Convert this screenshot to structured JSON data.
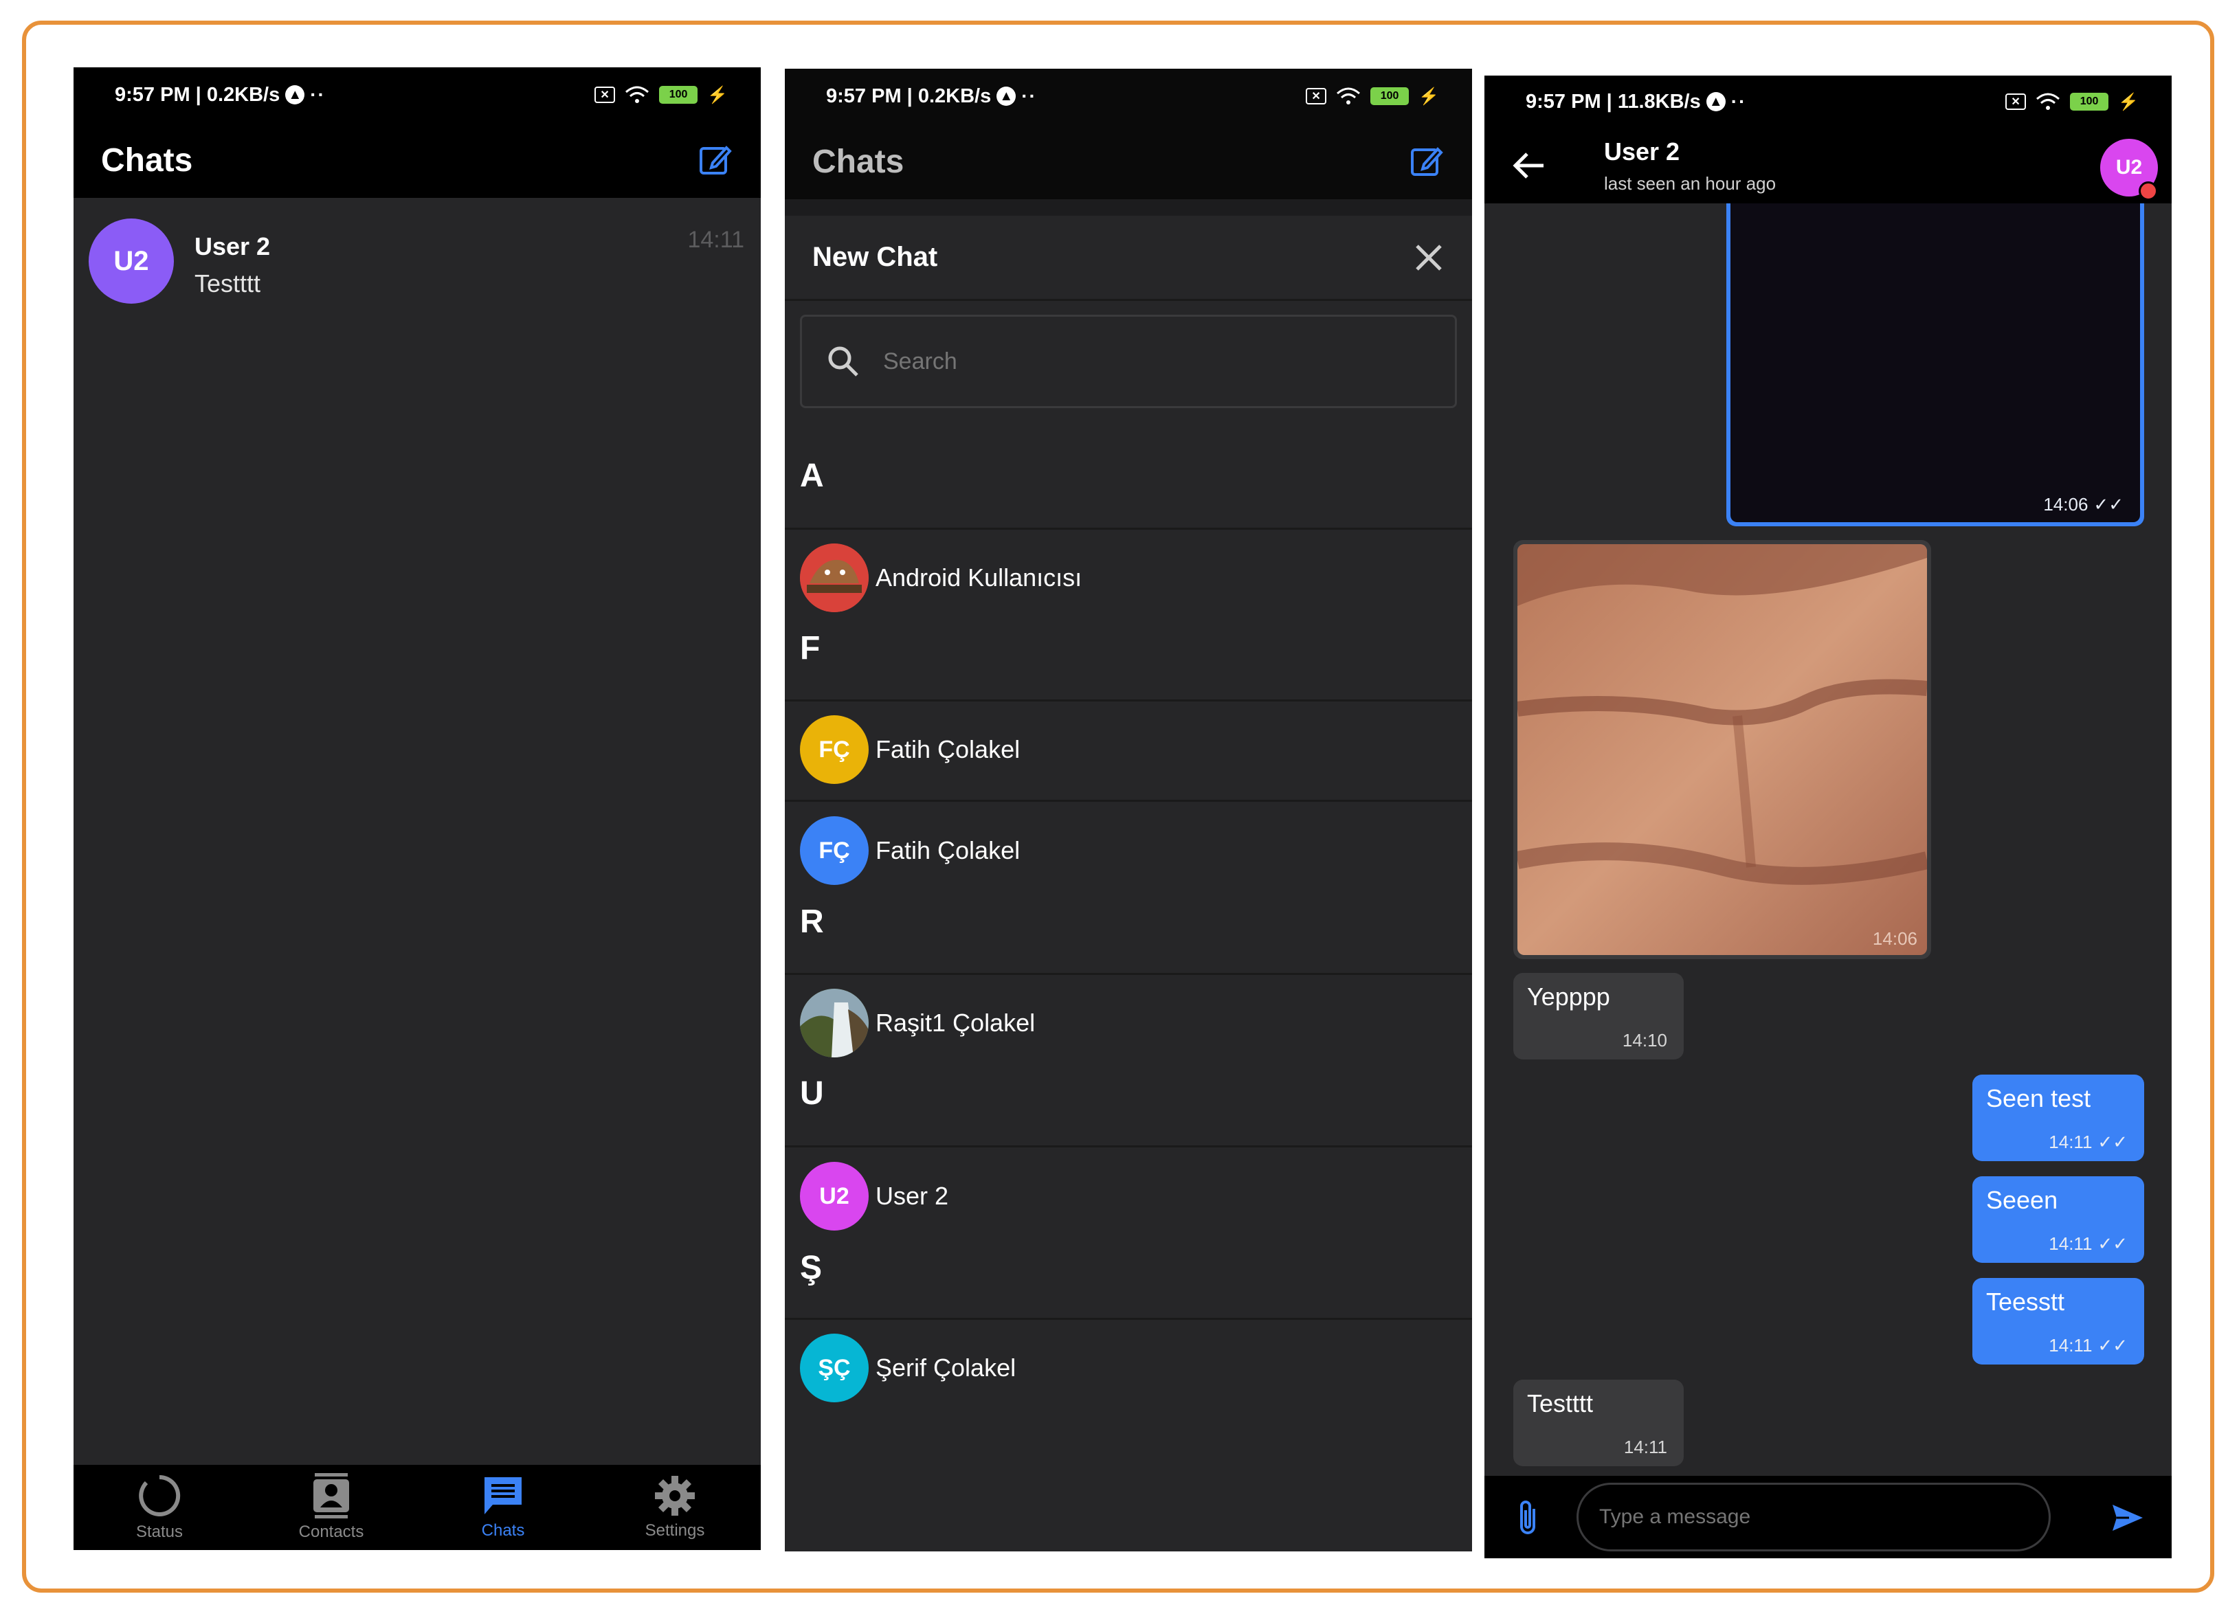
{
  "colors": {
    "frame": "#e8923a",
    "accent": "#3b82f6",
    "bg": "#262628",
    "bar": "#000000"
  },
  "screen1": {
    "status": {
      "time": "9:57 PM | 0.2KB/s",
      "battery": "100"
    },
    "title": "Chats",
    "compose_icon": "edit-icon",
    "chats": [
      {
        "avatar": "U2",
        "name": "User 2",
        "preview": "Testttt",
        "time": "14:11",
        "avatar_color": "#8b5cf6"
      }
    ],
    "nav": [
      {
        "label": "Status",
        "icon": "status-icon"
      },
      {
        "label": "Contacts",
        "icon": "contacts-icon"
      },
      {
        "label": "Chats",
        "icon": "chats-icon",
        "active": true
      },
      {
        "label": "Settings",
        "icon": "gear-icon"
      }
    ]
  },
  "screen2": {
    "status": {
      "time": "9:57 PM | 0.2KB/s",
      "battery": "100"
    },
    "title": "Chats",
    "sheet_title": "New Chat",
    "search_placeholder": "Search",
    "sections": [
      {
        "letter": "A",
        "contacts": [
          {
            "name": "Android Kullanıcısı",
            "avatar": "",
            "avatar_color": "#e0443c"
          }
        ]
      },
      {
        "letter": "F",
        "contacts": [
          {
            "name": "Fatih Çolakel",
            "avatar": "FÇ",
            "avatar_color": "#eab308"
          },
          {
            "name": "Fatih Çolakel",
            "avatar": "FÇ",
            "avatar_color": "#3b82f6"
          }
        ]
      },
      {
        "letter": "R",
        "contacts": [
          {
            "name": "Raşit1 Çolakel",
            "avatar": "",
            "avatar_color": "#6b8f5a"
          }
        ]
      },
      {
        "letter": "U",
        "contacts": [
          {
            "name": "User 2",
            "avatar": "U2",
            "avatar_color": "#d946ef"
          }
        ]
      },
      {
        "letter": "Ş",
        "contacts": [
          {
            "name": "Şerif Çolakel",
            "avatar": "ŞÇ",
            "avatar_color": "#06b6d4"
          }
        ]
      }
    ]
  },
  "screen3": {
    "status": {
      "time": "9:57 PM | 11.8KB/s",
      "battery": "100"
    },
    "contact_name": "User 2",
    "last_seen": "last seen an hour ago",
    "avatar": "U2",
    "messages": [
      {
        "kind": "image-out",
        "time": "14:06"
      },
      {
        "kind": "image-in",
        "time": "14:06"
      },
      {
        "kind": "in",
        "text": "Yepppp",
        "time": "14:10"
      },
      {
        "kind": "out",
        "text": "Seen test",
        "time": "14:11"
      },
      {
        "kind": "out",
        "text": "Seeen",
        "time": "14:11"
      },
      {
        "kind": "out",
        "text": "Teesstt",
        "time": "14:11"
      },
      {
        "kind": "in",
        "text": "Testttt",
        "time": "14:11"
      }
    ],
    "input_placeholder": "Type a message"
  }
}
